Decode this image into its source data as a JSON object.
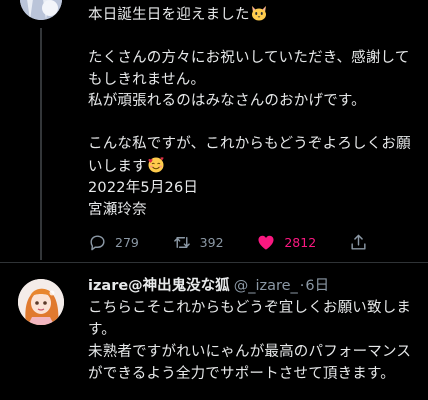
{
  "tweet": {
    "line1": "本日誕生日を迎えました",
    "line1_emoji": "cat-face-emoji",
    "para2": "たくさんの方々にお祝いしていただき、感謝してもしきれません。\n私が頑張れるのはみなさんのおかげです。",
    "para3": "こんな私ですが、これからもどうぞよろしくお願いします",
    "para3_emoji": "smiling-face-with-hearts-emoji",
    "date": "2022年5月26日",
    "signature": "宮瀬玲奈",
    "reply_count": "279",
    "retweet_count": "392",
    "like_count": "2812",
    "icons": {
      "reply": "reply-icon",
      "retweet": "retweet-icon",
      "like": "heart-icon",
      "share": "share-icon"
    },
    "like_color": "#f91880"
  },
  "reply": {
    "name": "izare@神出鬼没な狐",
    "handle": "@_izare_",
    "dot": "·",
    "time": "6日",
    "text": "こちらこそこれからもどうぞ宜しくお願い致します。\n未熟者ですがれいにゃんが最高のパフォーマンスができるよう全力でサポートさせて頂きます。"
  },
  "theme": {
    "background": "#000000",
    "text": "#e7e9ea",
    "muted": "#8b98a5",
    "divider": "#2f3336"
  }
}
